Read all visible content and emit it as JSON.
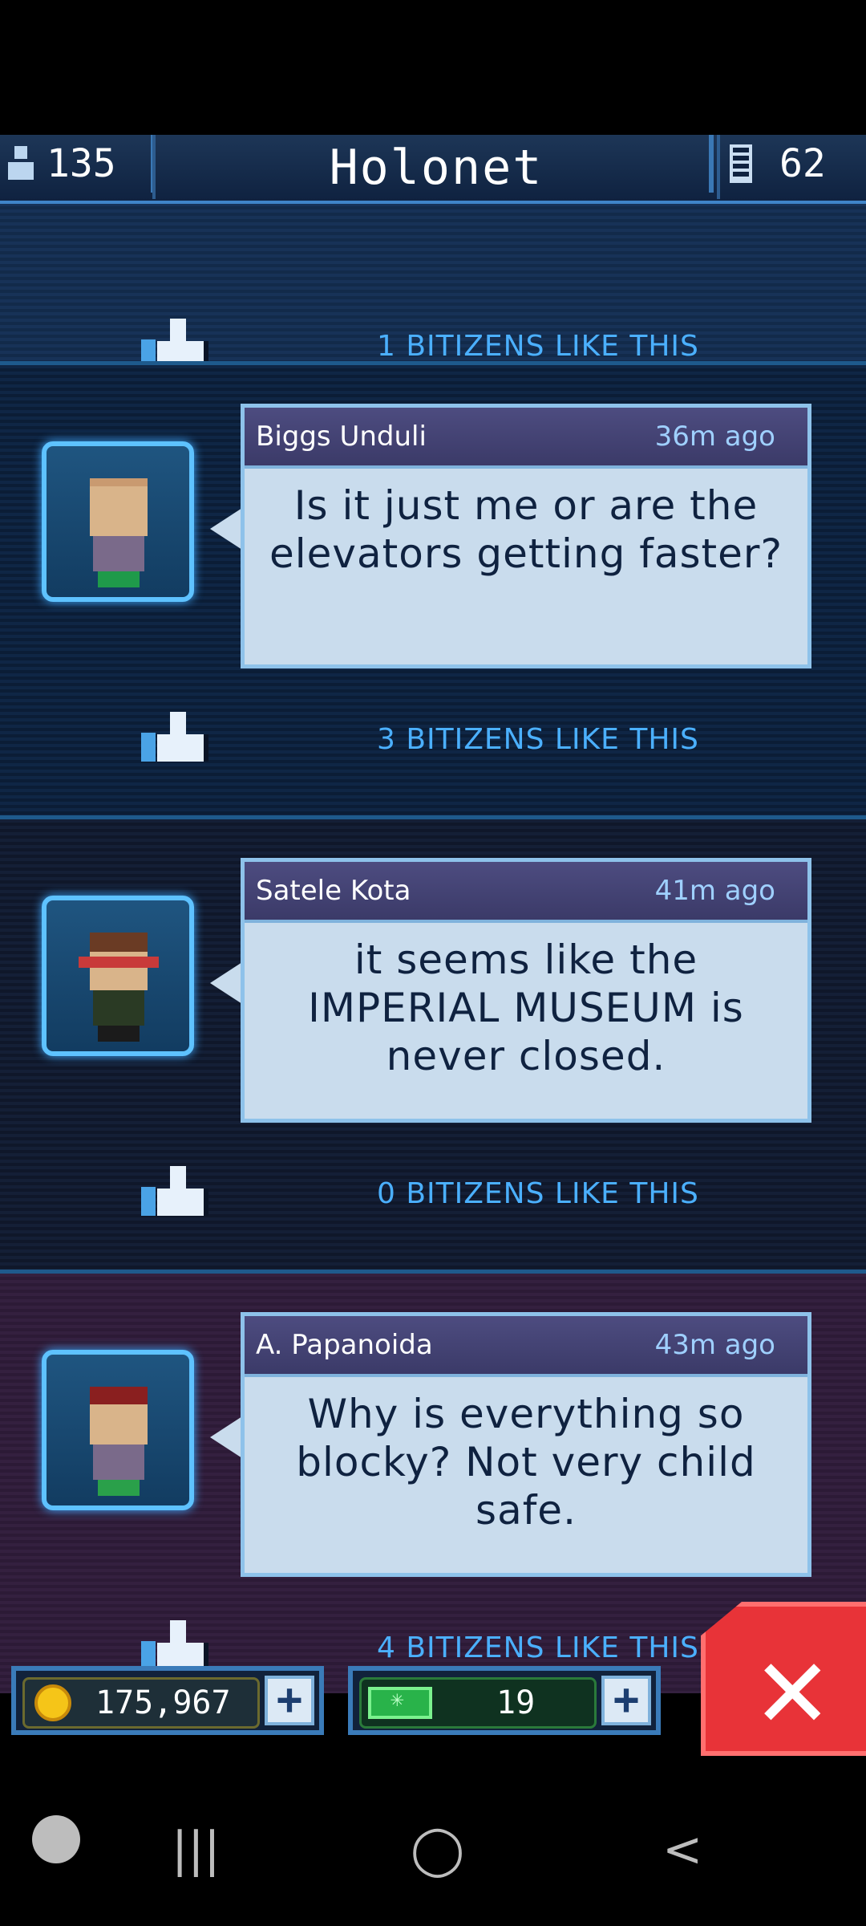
{
  "topbar": {
    "population": "135",
    "title": "Holonet",
    "floors": "62"
  },
  "posts": [
    {
      "likes_text": "1 BITIZENS LIKE THIS"
    },
    {
      "author": "Biggs Unduli",
      "time": "36m ago",
      "message": "Is it just me or are the elevators getting faster?",
      "likes_text": "3 BITIZENS LIKE THIS"
    },
    {
      "author": "Satele Kota",
      "time": "41m ago",
      "message": "it seems like the IMPERIAL MUSEUM is never closed.",
      "likes_text": "0 BITIZENS LIKE THIS"
    },
    {
      "author": "A. Papanoida",
      "time": "43m ago",
      "message": "Why is everything so blocky? Not very child safe.",
      "likes_text": "4 BITIZENS LIKE THIS"
    }
  ],
  "currency": {
    "coins": "175,967",
    "bux": "19"
  },
  "colors": {
    "accent": "#4bb0ff",
    "close": "#e83338"
  },
  "sysnav": {
    "recents_icon": "|||",
    "home_icon": "◯",
    "back_icon": "<"
  }
}
